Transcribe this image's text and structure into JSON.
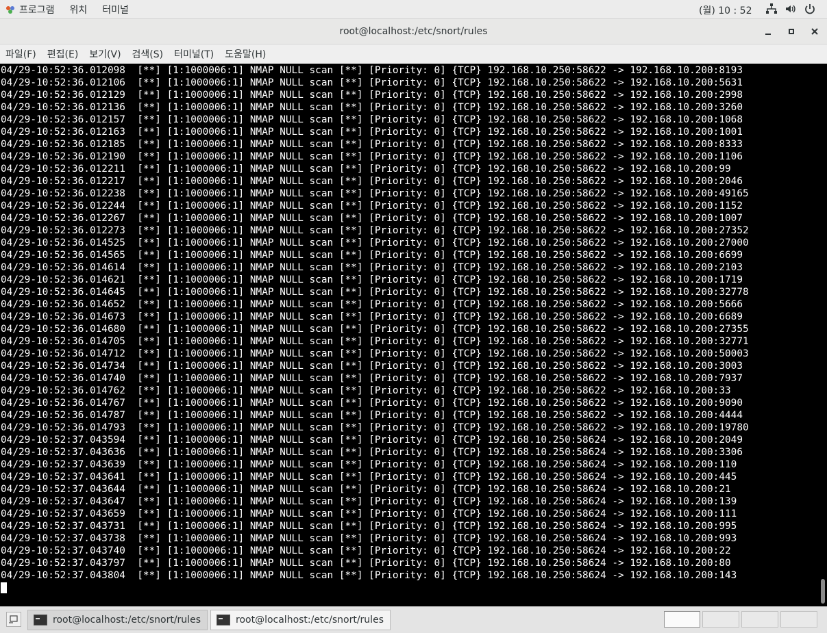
{
  "topbar": {
    "menus": [
      "프로그램",
      "위치",
      "터미널"
    ],
    "clock": "(월) 10 : 52"
  },
  "window": {
    "title": "root@localhost:/etc/snort/rules",
    "menubar": [
      "파일(F)",
      "편집(E)",
      "보기(V)",
      "검색(S)",
      "터미널(T)",
      "도움말(H)"
    ]
  },
  "terminal": {
    "lines": [
      "04/29-10:52:36.012098  [**] [1:1000006:1] NMAP NULL scan [**] [Priority: 0] {TCP} 192.168.10.250:58622 -> 192.168.10.200:8193",
      "04/29-10:52:36.012106  [**] [1:1000006:1] NMAP NULL scan [**] [Priority: 0] {TCP} 192.168.10.250:58622 -> 192.168.10.200:5631",
      "04/29-10:52:36.012129  [**] [1:1000006:1] NMAP NULL scan [**] [Priority: 0] {TCP} 192.168.10.250:58622 -> 192.168.10.200:2998",
      "04/29-10:52:36.012136  [**] [1:1000006:1] NMAP NULL scan [**] [Priority: 0] {TCP} 192.168.10.250:58622 -> 192.168.10.200:3260",
      "04/29-10:52:36.012157  [**] [1:1000006:1] NMAP NULL scan [**] [Priority: 0] {TCP} 192.168.10.250:58622 -> 192.168.10.200:1068",
      "04/29-10:52:36.012163  [**] [1:1000006:1] NMAP NULL scan [**] [Priority: 0] {TCP} 192.168.10.250:58622 -> 192.168.10.200:1001",
      "04/29-10:52:36.012185  [**] [1:1000006:1] NMAP NULL scan [**] [Priority: 0] {TCP} 192.168.10.250:58622 -> 192.168.10.200:8333",
      "04/29-10:52:36.012190  [**] [1:1000006:1] NMAP NULL scan [**] [Priority: 0] {TCP} 192.168.10.250:58622 -> 192.168.10.200:1106",
      "04/29-10:52:36.012211  [**] [1:1000006:1] NMAP NULL scan [**] [Priority: 0] {TCP} 192.168.10.250:58622 -> 192.168.10.200:99",
      "04/29-10:52:36.012217  [**] [1:1000006:1] NMAP NULL scan [**] [Priority: 0] {TCP} 192.168.10.250:58622 -> 192.168.10.200:2046",
      "04/29-10:52:36.012238  [**] [1:1000006:1] NMAP NULL scan [**] [Priority: 0] {TCP} 192.168.10.250:58622 -> 192.168.10.200:49165",
      "04/29-10:52:36.012244  [**] [1:1000006:1] NMAP NULL scan [**] [Priority: 0] {TCP} 192.168.10.250:58622 -> 192.168.10.200:1152",
      "04/29-10:52:36.012267  [**] [1:1000006:1] NMAP NULL scan [**] [Priority: 0] {TCP} 192.168.10.250:58622 -> 192.168.10.200:1007",
      "04/29-10:52:36.012273  [**] [1:1000006:1] NMAP NULL scan [**] [Priority: 0] {TCP} 192.168.10.250:58622 -> 192.168.10.200:27352",
      "04/29-10:52:36.014525  [**] [1:1000006:1] NMAP NULL scan [**] [Priority: 0] {TCP} 192.168.10.250:58622 -> 192.168.10.200:27000",
      "04/29-10:52:36.014565  [**] [1:1000006:1] NMAP NULL scan [**] [Priority: 0] {TCP} 192.168.10.250:58622 -> 192.168.10.200:6699",
      "04/29-10:52:36.014614  [**] [1:1000006:1] NMAP NULL scan [**] [Priority: 0] {TCP} 192.168.10.250:58622 -> 192.168.10.200:2103",
      "04/29-10:52:36.014621  [**] [1:1000006:1] NMAP NULL scan [**] [Priority: 0] {TCP} 192.168.10.250:58622 -> 192.168.10.200:1719",
      "04/29-10:52:36.014645  [**] [1:1000006:1] NMAP NULL scan [**] [Priority: 0] {TCP} 192.168.10.250:58622 -> 192.168.10.200:32778",
      "04/29-10:52:36.014652  [**] [1:1000006:1] NMAP NULL scan [**] [Priority: 0] {TCP} 192.168.10.250:58622 -> 192.168.10.200:5666",
      "04/29-10:52:36.014673  [**] [1:1000006:1] NMAP NULL scan [**] [Priority: 0] {TCP} 192.168.10.250:58622 -> 192.168.10.200:6689",
      "04/29-10:52:36.014680  [**] [1:1000006:1] NMAP NULL scan [**] [Priority: 0] {TCP} 192.168.10.250:58622 -> 192.168.10.200:27355",
      "04/29-10:52:36.014705  [**] [1:1000006:1] NMAP NULL scan [**] [Priority: 0] {TCP} 192.168.10.250:58622 -> 192.168.10.200:32771",
      "04/29-10:52:36.014712  [**] [1:1000006:1] NMAP NULL scan [**] [Priority: 0] {TCP} 192.168.10.250:58622 -> 192.168.10.200:50003",
      "04/29-10:52:36.014734  [**] [1:1000006:1] NMAP NULL scan [**] [Priority: 0] {TCP} 192.168.10.250:58622 -> 192.168.10.200:3003",
      "04/29-10:52:36.014740  [**] [1:1000006:1] NMAP NULL scan [**] [Priority: 0] {TCP} 192.168.10.250:58622 -> 192.168.10.200:7937",
      "04/29-10:52:36.014762  [**] [1:1000006:1] NMAP NULL scan [**] [Priority: 0] {TCP} 192.168.10.250:58622 -> 192.168.10.200:33",
      "04/29-10:52:36.014767  [**] [1:1000006:1] NMAP NULL scan [**] [Priority: 0] {TCP} 192.168.10.250:58622 -> 192.168.10.200:9090",
      "04/29-10:52:36.014787  [**] [1:1000006:1] NMAP NULL scan [**] [Priority: 0] {TCP} 192.168.10.250:58622 -> 192.168.10.200:4444",
      "04/29-10:52:36.014793  [**] [1:1000006:1] NMAP NULL scan [**] [Priority: 0] {TCP} 192.168.10.250:58622 -> 192.168.10.200:19780",
      "04/29-10:52:37.043594  [**] [1:1000006:1] NMAP NULL scan [**] [Priority: 0] {TCP} 192.168.10.250:58624 -> 192.168.10.200:2049",
      "04/29-10:52:37.043636  [**] [1:1000006:1] NMAP NULL scan [**] [Priority: 0] {TCP} 192.168.10.250:58624 -> 192.168.10.200:3306",
      "04/29-10:52:37.043639  [**] [1:1000006:1] NMAP NULL scan [**] [Priority: 0] {TCP} 192.168.10.250:58624 -> 192.168.10.200:110",
      "04/29-10:52:37.043641  [**] [1:1000006:1] NMAP NULL scan [**] [Priority: 0] {TCP} 192.168.10.250:58624 -> 192.168.10.200:445",
      "04/29-10:52:37.043644  [**] [1:1000006:1] NMAP NULL scan [**] [Priority: 0] {TCP} 192.168.10.250:58624 -> 192.168.10.200:21",
      "04/29-10:52:37.043647  [**] [1:1000006:1] NMAP NULL scan [**] [Priority: 0] {TCP} 192.168.10.250:58624 -> 192.168.10.200:139",
      "04/29-10:52:37.043659  [**] [1:1000006:1] NMAP NULL scan [**] [Priority: 0] {TCP} 192.168.10.250:58624 -> 192.168.10.200:111",
      "04/29-10:52:37.043731  [**] [1:1000006:1] NMAP NULL scan [**] [Priority: 0] {TCP} 192.168.10.250:58624 -> 192.168.10.200:995",
      "04/29-10:52:37.043738  [**] [1:1000006:1] NMAP NULL scan [**] [Priority: 0] {TCP} 192.168.10.250:58624 -> 192.168.10.200:993",
      "04/29-10:52:37.043740  [**] [1:1000006:1] NMAP NULL scan [**] [Priority: 0] {TCP} 192.168.10.250:58624 -> 192.168.10.200:22",
      "04/29-10:52:37.043797  [**] [1:1000006:1] NMAP NULL scan [**] [Priority: 0] {TCP} 192.168.10.250:58624 -> 192.168.10.200:80",
      "04/29-10:52:37.043804  [**] [1:1000006:1] NMAP NULL scan [**] [Priority: 0] {TCP} 192.168.10.250:58624 -> 192.168.10.200:143"
    ]
  },
  "taskbar": {
    "tasks": [
      "root@localhost:/etc/snort/rules",
      "root@localhost:/etc/snort/rules"
    ]
  },
  "colors": {
    "terminal_bg": "#000000",
    "terminal_fg": "#ffffff"
  },
  "icons": {
    "apps": "app-menu-icon",
    "network": "network-icon",
    "volume": "volume-icon",
    "power": "power-icon",
    "minimize": "minimize-icon",
    "maximize": "maximize-icon",
    "close": "close-icon",
    "terminal": "terminal-icon",
    "show_desktop": "show-desktop-icon"
  }
}
